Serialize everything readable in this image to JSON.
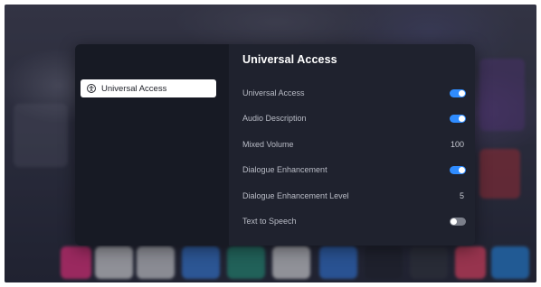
{
  "panel": {
    "title": "Universal Access",
    "nav": {
      "items": [
        {
          "label": "Universal Access",
          "icon": "accessibility-icon",
          "selected": true
        }
      ]
    },
    "settings": [
      {
        "label": "Universal Access",
        "type": "toggle",
        "on": true
      },
      {
        "label": "Audio Description",
        "type": "toggle",
        "on": true
      },
      {
        "label": "Mixed Volume",
        "type": "value",
        "value": "100"
      },
      {
        "label": "Dialogue Enhancement",
        "type": "toggle",
        "on": true
      },
      {
        "label": "Dialogue Enhancement Level",
        "type": "value",
        "value": "5"
      },
      {
        "label": "Text to Speech",
        "type": "toggle",
        "on": false
      }
    ]
  },
  "colors": {
    "toggle_on": "#2f8cff",
    "toggle_off": "#7b7f8a",
    "panel_bg": "#1f222e",
    "nav_bg": "#171a24"
  }
}
